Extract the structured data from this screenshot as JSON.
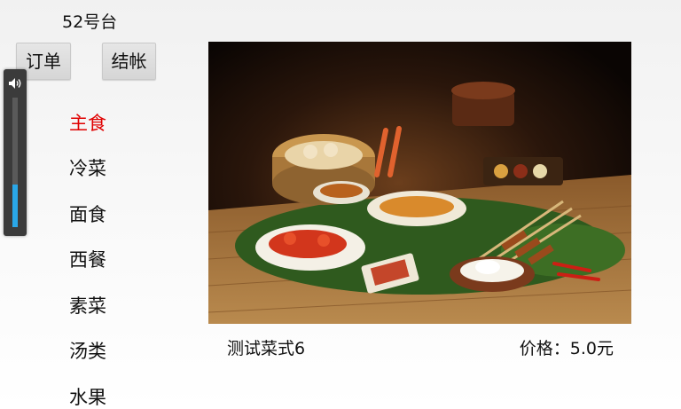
{
  "header": {
    "table_label": "52号台"
  },
  "toolbar": {
    "orders_label": "订单",
    "checkout_label": "结帐"
  },
  "volume": {
    "icon": "speaker-icon",
    "level": 0.33,
    "accent": "#2aa7e8"
  },
  "categories": [
    {
      "label": "主食",
      "active": true
    },
    {
      "label": "冷菜",
      "active": false
    },
    {
      "label": "面食",
      "active": false
    },
    {
      "label": "西餐",
      "active": false
    },
    {
      "label": "素菜",
      "active": false
    },
    {
      "label": "汤类",
      "active": false
    },
    {
      "label": "水果",
      "active": false
    }
  ],
  "dish": {
    "name": "测试菜式6",
    "price": "价格：5.0元"
  },
  "colors": {
    "active_category": "#e00000"
  }
}
